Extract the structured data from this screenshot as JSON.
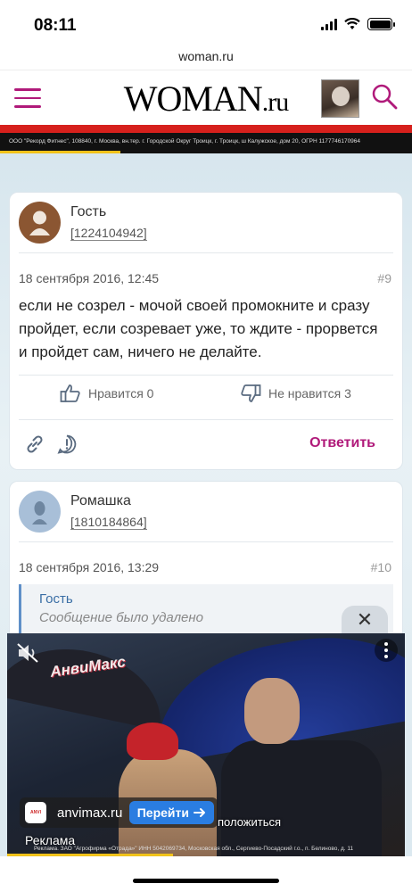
{
  "status_bar": {
    "time": "08:11"
  },
  "browser": {
    "url": "woman.ru"
  },
  "site": {
    "logo_main": "WOMAN",
    "logo_suffix": ".ru",
    "ad_strip_text": "ООО \"Рекорд Фитнес\", 108840, г. Москва, вн.тер. г. Городской Округ Троицк, г. Троицк, ш Калужское, дом 20, ОГРН 1177746170964",
    "ad_strip_progress": 0.29
  },
  "comments": [
    {
      "author": "Гость",
      "user_id": "1224104942",
      "date": "18 сентября 2016, 12:45",
      "number": "#9",
      "text": "если не созрел - мочой своей промокните и сразу пройдет, если созревает уже, то ждите - прорвется и пройдет сам, ничего не делайте.",
      "like_label": "Нравится 0",
      "dislike_label": "Не нравится 3",
      "reply_label": "Ответить"
    },
    {
      "author": "Ромашка",
      "user_id": "1810184864",
      "date": "18 сентября 2016, 13:29",
      "number": "#10",
      "quote_author": "Гость",
      "quote_text": "Сообщение было удалено"
    }
  ],
  "video_ad": {
    "brand": "АнвиМакс",
    "domain": "anvimax.ru",
    "go_label": "Перейти",
    "subtitle": "положиться",
    "ad_label": "Реклама",
    "small_print": "Реклама. ЗАО \"Агрофирма «Отрада»\" ИНН 5042069734, Московская обл., Сергиево-Посадский г.о., п. Белиново, д. 11",
    "progress": 0.42,
    "close_symbol": "✕"
  },
  "colors": {
    "accent": "#b01a7a",
    "link_blue": "#3a6ea5",
    "cta_blue": "#2a7de1"
  }
}
